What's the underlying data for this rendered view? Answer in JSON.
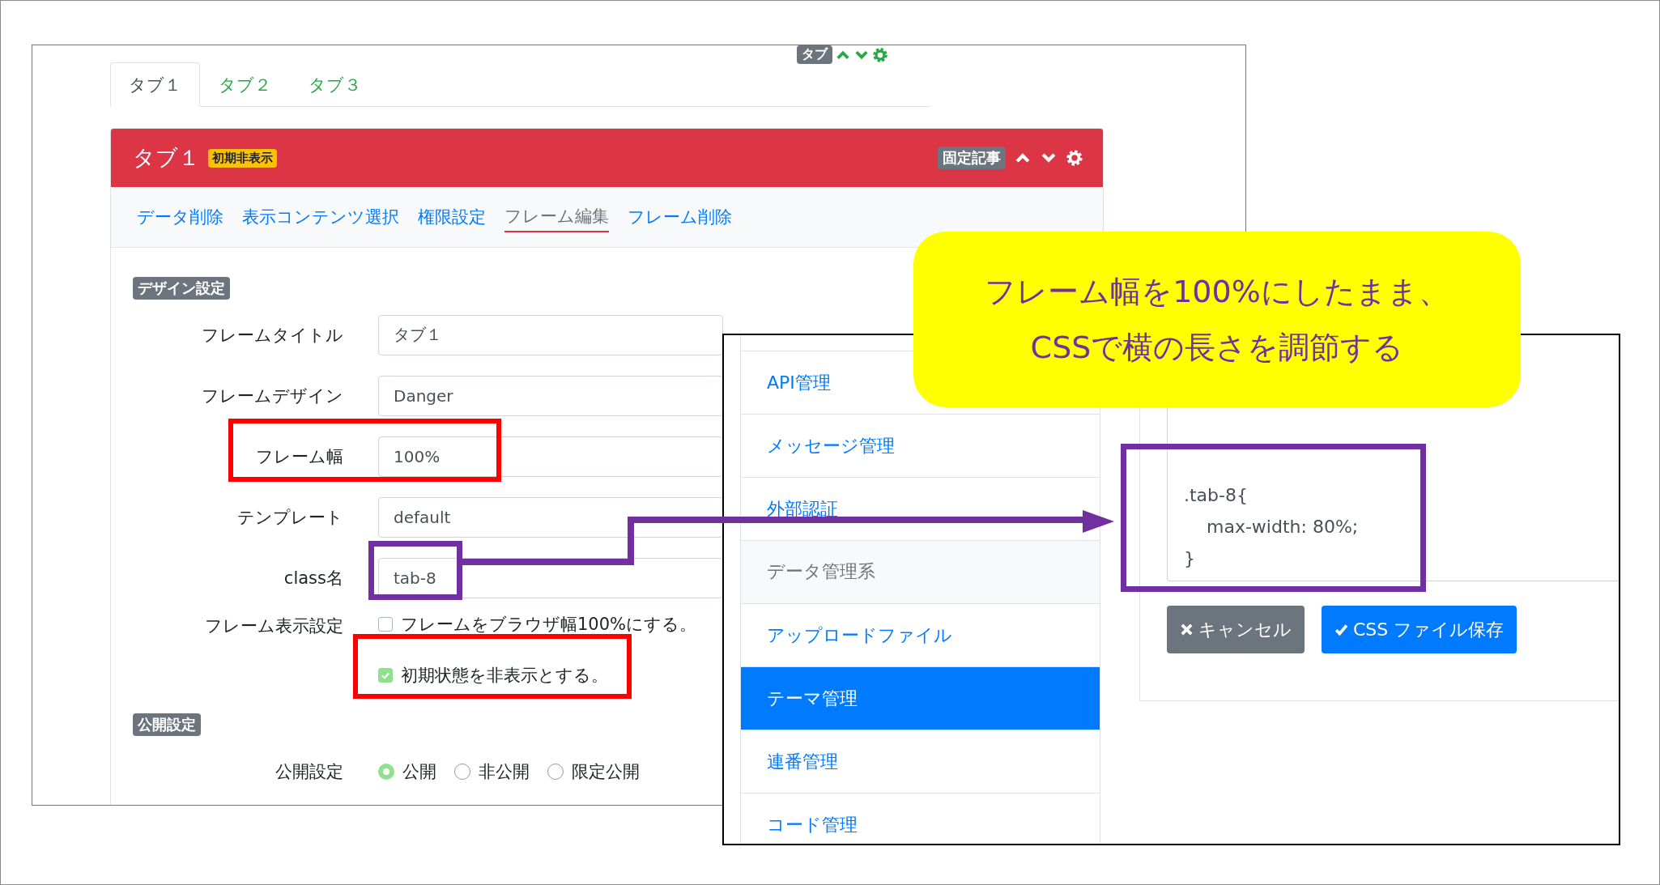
{
  "page_screenshot": {
    "top_frame_badge": "タブ",
    "tabs": [
      {
        "label": "タブ１",
        "selected": true
      },
      {
        "label": "タブ２",
        "selected": false
      },
      {
        "label": "タブ３",
        "selected": false
      }
    ],
    "frame": {
      "title": "タブ１",
      "hidden_badge": "初期非表示",
      "pinned_badge": "固定記事",
      "actions": [
        {
          "label": "データ削除",
          "selected": false
        },
        {
          "label": "表示コンテンツ選択",
          "selected": false
        },
        {
          "label": "権限設定",
          "selected": false
        },
        {
          "label": "フレーム編集",
          "selected": true
        },
        {
          "label": "フレーム削除",
          "selected": false
        }
      ],
      "sections": [
        {
          "heading": "デザイン設定",
          "fields": [
            {
              "kind": "text",
              "label": "フレームタイトル",
              "value": "タブ１"
            },
            {
              "kind": "text",
              "label": "フレームデザイン",
              "value": "Danger"
            },
            {
              "kind": "text",
              "label": "フレーム幅",
              "value": "100%"
            },
            {
              "kind": "text",
              "label": "テンプレート",
              "value": "default"
            },
            {
              "kind": "text",
              "label": "class名",
              "value": "tab-8"
            },
            {
              "kind": "checkboxes",
              "label": "フレーム表示設定",
              "options": [
                {
                  "label": "フレームをブラウザ幅100%にする。",
                  "checked": false
                },
                {
                  "label": "初期状態を非表示とする。",
                  "checked": true
                }
              ]
            }
          ]
        },
        {
          "heading": "公開設定",
          "fields": [
            {
              "kind": "radios",
              "label": "公開設定",
              "options": [
                {
                  "label": "公開",
                  "selected": true
                },
                {
                  "label": "非公開",
                  "selected": false
                },
                {
                  "label": "限定公開",
                  "selected": false
                }
              ]
            }
          ]
        }
      ]
    }
  },
  "admin_screenshot": {
    "menu": [
      {
        "kind": "link",
        "label": "API管理",
        "selected": false
      },
      {
        "kind": "link",
        "label": "メッセージ管理",
        "selected": false
      },
      {
        "kind": "link",
        "label": "外部認証",
        "selected": false
      },
      {
        "kind": "header",
        "label": "データ管理系",
        "selected": false
      },
      {
        "kind": "link",
        "label": "アップロードファイル",
        "selected": false
      },
      {
        "kind": "link",
        "label": "テーマ管理",
        "selected": true
      },
      {
        "kind": "link",
        "label": "連番管理",
        "selected": false
      },
      {
        "kind": "link",
        "label": "コード管理",
        "selected": false
      }
    ],
    "css_code": [
      ".tab-8{",
      "    max-width: 80%;",
      "}"
    ],
    "buttons": [
      {
        "kind": "cancel",
        "label": "キャンセル"
      },
      {
        "kind": "save",
        "label": "CSS ファイル保存"
      }
    ]
  },
  "callout": {
    "lines": [
      "フレーム幅を100%にしたまま、",
      "CSSで横の長さを調節する"
    ]
  }
}
